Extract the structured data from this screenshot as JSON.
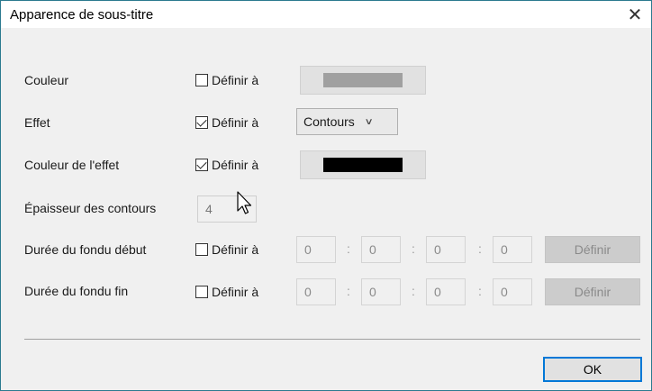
{
  "dialog": {
    "title": "Apparence de sous-titre",
    "close_glyph": "✕"
  },
  "rows": {
    "color": {
      "label": "Couleur",
      "define_label": "Définir à",
      "checked": false,
      "swatch_color": "#a0a0a0"
    },
    "effect": {
      "label": "Effet",
      "define_label": "Définir à",
      "checked": true,
      "selected": "Contours"
    },
    "effect_color": {
      "label": "Couleur de l'effet",
      "define_label": "Définir à",
      "checked": true,
      "swatch_color": "#000000"
    },
    "outline_thickness": {
      "label": "Épaisseur des contours",
      "value": "4"
    },
    "fade_in": {
      "label": "Durée du fondu début",
      "define_label": "Définir à",
      "checked": false,
      "fields": [
        "0",
        "0",
        "0",
        "0"
      ],
      "separator": ":",
      "button": "Définir"
    },
    "fade_out": {
      "label": "Durée du fondu fin",
      "define_label": "Définir à",
      "checked": false,
      "fields": [
        "0",
        "0",
        "0",
        "0"
      ],
      "separator": ":",
      "button": "Définir"
    }
  },
  "footer": {
    "ok_label": "OK"
  },
  "icons": {
    "close": "close-icon",
    "dropdown": "chevron-down-icon",
    "cursor": "mouse-cursor-icon"
  }
}
